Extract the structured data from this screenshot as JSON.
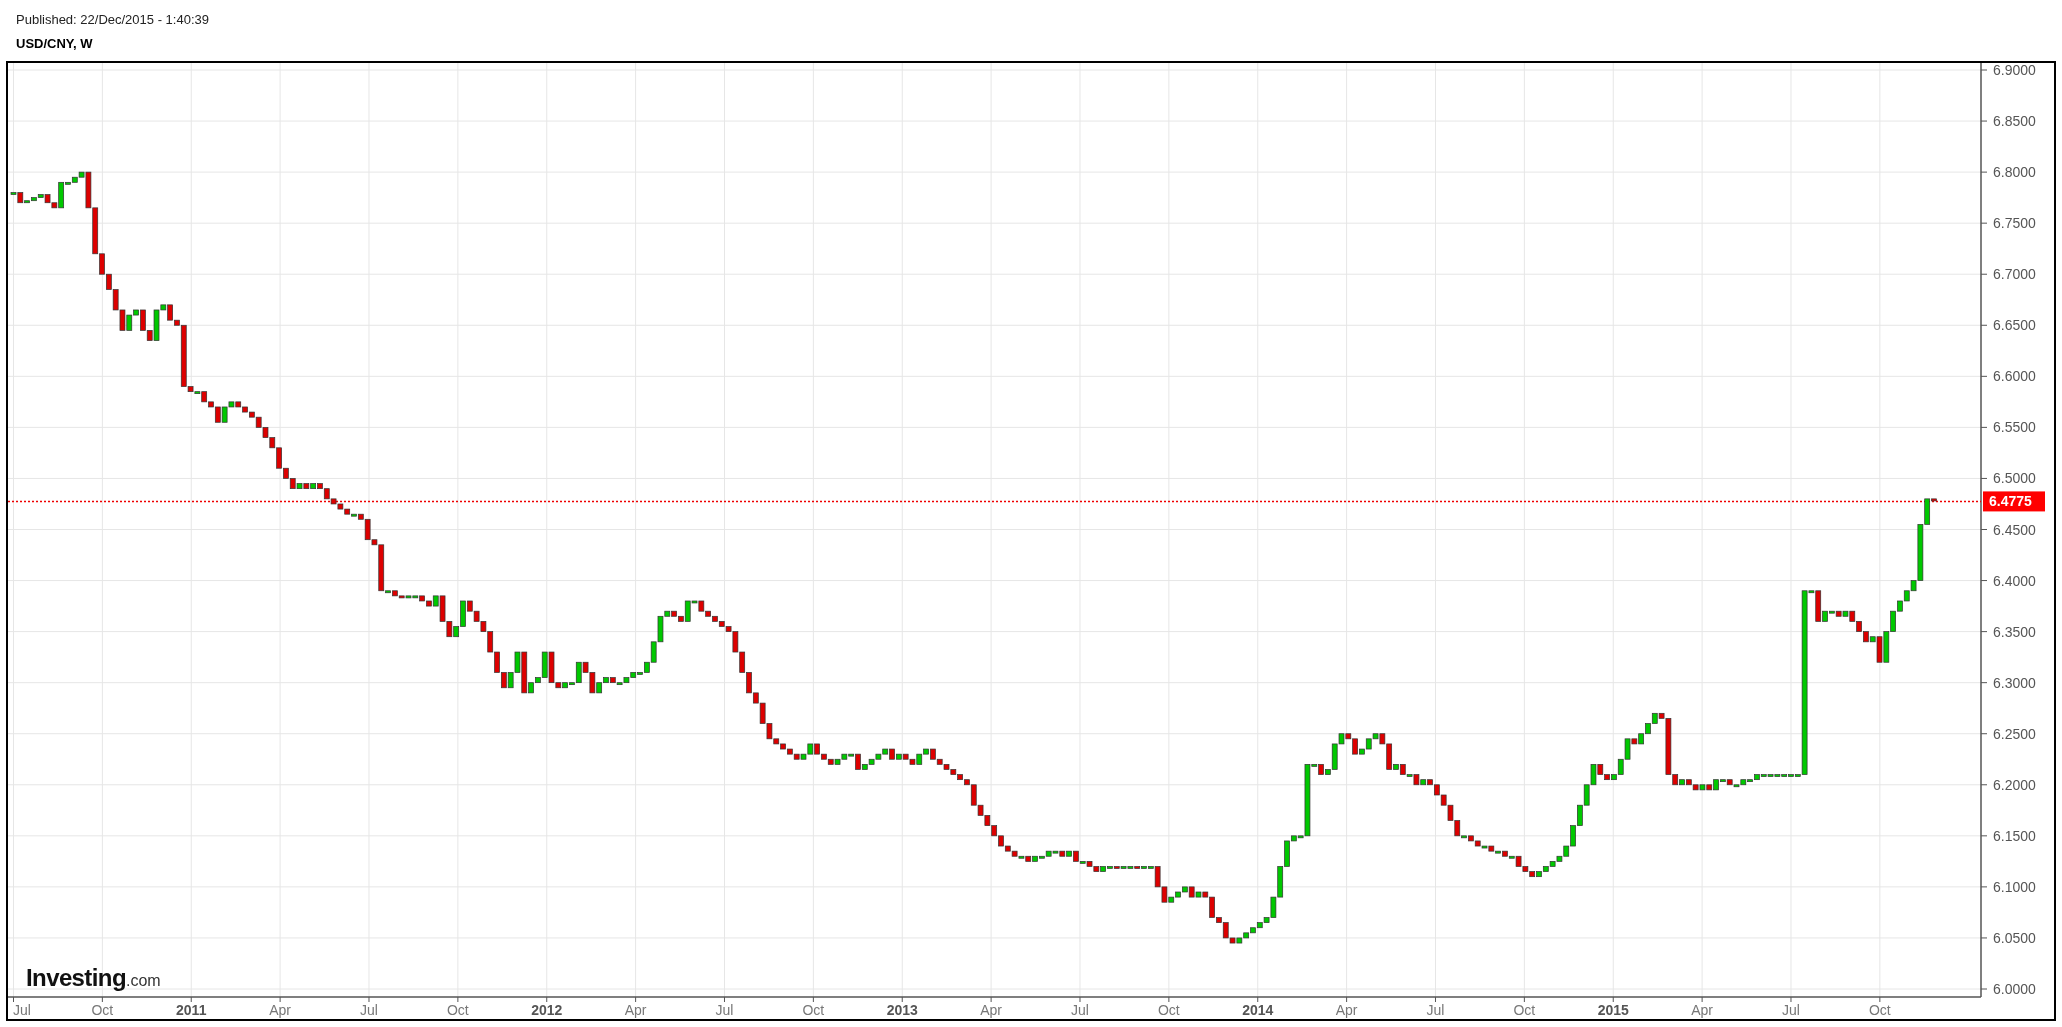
{
  "header": {
    "published": "Published: 22/Dec/2015 - 1:40:39",
    "symbol": "USD/CNY, W"
  },
  "chart": {
    "last_price": "6.4775",
    "logo": {
      "name": "Investing",
      "suffix": ".com"
    },
    "y_axis_labels": [
      "6.9000",
      "6.8500",
      "6.8000",
      "6.7500",
      "6.7000",
      "6.6500",
      "6.6000",
      "6.5500",
      "6.5000",
      "6.4500",
      "6.4000",
      "6.3500",
      "6.3000",
      "6.2500",
      "6.2000",
      "6.1500",
      "6.1000",
      "6.0500",
      "6.0000"
    ],
    "x_axis_labels": [
      {
        "label": "Jul",
        "year": false
      },
      {
        "label": "Oct",
        "year": false
      },
      {
        "label": "2011",
        "year": true
      },
      {
        "label": "Apr",
        "year": false
      },
      {
        "label": "Jul",
        "year": false
      },
      {
        "label": "Oct",
        "year": false
      },
      {
        "label": "2012",
        "year": true
      },
      {
        "label": "Apr",
        "year": false
      },
      {
        "label": "Jul",
        "year": false
      },
      {
        "label": "Oct",
        "year": false
      },
      {
        "label": "2013",
        "year": true
      },
      {
        "label": "Apr",
        "year": false
      },
      {
        "label": "Jul",
        "year": false
      },
      {
        "label": "Oct",
        "year": false
      },
      {
        "label": "2014",
        "year": true
      },
      {
        "label": "Apr",
        "year": false
      },
      {
        "label": "Jul",
        "year": false
      },
      {
        "label": "Oct",
        "year": false
      },
      {
        "label": "2015",
        "year": true
      },
      {
        "label": "Apr",
        "year": false
      },
      {
        "label": "Jul",
        "year": false
      },
      {
        "label": "Oct",
        "year": false
      }
    ]
  }
}
